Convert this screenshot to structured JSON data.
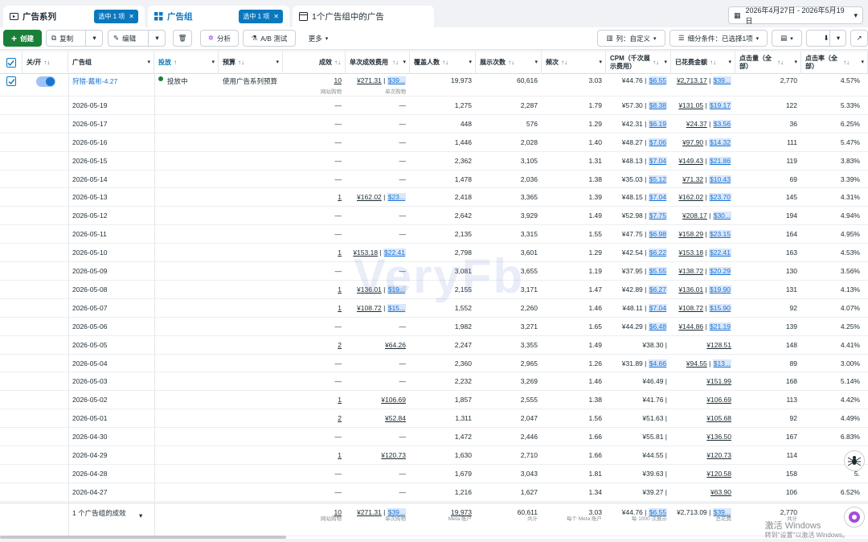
{
  "tabs": {
    "campaigns": {
      "label": "广告系列"
    },
    "adsets": {
      "label": "广告组",
      "badge": "选中 1 项"
    },
    "ads": {
      "label": "1个广告组中的广告"
    },
    "campaigns_badge": "选中 1 项"
  },
  "date_range": "2026年4月27日 - 2026年5月19日",
  "toolbar": {
    "create": "创建",
    "copy": "复制",
    "edit": "编辑",
    "analyze": "分析",
    "abtest": "A/B 测试",
    "more": "更多",
    "columns": "列：自定义",
    "breakdown": "细分条件：已选择1项"
  },
  "headers": {
    "toggle": "关/开",
    "adset": "广告组",
    "delivery": "投放",
    "budget": "预算",
    "results": "成效",
    "cost_per_result": "单次成效费用",
    "reach": "覆盖人数",
    "impressions": "展示次数",
    "frequency": "频次",
    "cpm": "CPM（千次展示费用）",
    "spend": "已花费金额",
    "clicks": "点击量（全部）",
    "ctr": "点击率（全部）"
  },
  "main_row": {
    "name": "狩猎-戴彬-4.27",
    "delivery": "投放中",
    "budget": "使用广告系列预算",
    "results": "10",
    "results_sub": "网站购物",
    "cost": "¥271.31",
    "cost_usd": "$39...",
    "cost_sub": "单次购物",
    "reach": "19,973",
    "impressions": "60,616",
    "frequency": "3.03",
    "cpm": "¥44.76",
    "cpm_usd": "$6.55",
    "spend": "¥2,713.17",
    "spend_usd": "$39...",
    "clicks": "2,770",
    "ctr": "4.57%"
  },
  "rows": [
    {
      "date": "2026-05-19",
      "results": "—",
      "cost": "—",
      "cost_usd": "",
      "reach": "1,275",
      "impressions": "2,287",
      "frequency": "1.79",
      "cpm": "¥57.30",
      "cpm_usd": "$8.38",
      "spend": "¥131.05",
      "spend_usd": "$19.17",
      "clicks": "122",
      "ctr": "5.33%"
    },
    {
      "date": "2026-05-17",
      "results": "—",
      "cost": "—",
      "cost_usd": "",
      "reach": "448",
      "impressions": "576",
      "frequency": "1.29",
      "cpm": "¥42.31",
      "cpm_usd": "$6.19",
      "spend": "¥24.37",
      "spend_usd": "$3.56",
      "clicks": "36",
      "ctr": "6.25%"
    },
    {
      "date": "2026-05-16",
      "results": "—",
      "cost": "—",
      "cost_usd": "",
      "reach": "1,446",
      "impressions": "2,028",
      "frequency": "1.40",
      "cpm": "¥48.27",
      "cpm_usd": "$7.06",
      "spend": "¥97.90",
      "spend_usd": "$14.32",
      "clicks": "111",
      "ctr": "5.47%"
    },
    {
      "date": "2026-05-15",
      "results": "—",
      "cost": "—",
      "cost_usd": "",
      "reach": "2,362",
      "impressions": "3,105",
      "frequency": "1.31",
      "cpm": "¥48.13",
      "cpm_usd": "$7.04",
      "spend": "¥149.43",
      "spend_usd": "$21.86",
      "clicks": "119",
      "ctr": "3.83%"
    },
    {
      "date": "2026-05-14",
      "results": "—",
      "cost": "—",
      "cost_usd": "",
      "reach": "1,478",
      "impressions": "2,036",
      "frequency": "1.38",
      "cpm": "¥35.03",
      "cpm_usd": "$5.12",
      "spend": "¥71.32",
      "spend_usd": "$10.43",
      "clicks": "69",
      "ctr": "3.39%"
    },
    {
      "date": "2026-05-13",
      "results": "1",
      "cost": "¥162.02",
      "cost_usd": "$23...",
      "reach": "2,418",
      "impressions": "3,365",
      "frequency": "1.39",
      "cpm": "¥48.15",
      "cpm_usd": "$7.04",
      "spend": "¥162.02",
      "spend_usd": "$23.70",
      "clicks": "145",
      "ctr": "4.31%"
    },
    {
      "date": "2026-05-12",
      "results": "—",
      "cost": "—",
      "cost_usd": "",
      "reach": "2,642",
      "impressions": "3,929",
      "frequency": "1.49",
      "cpm": "¥52.98",
      "cpm_usd": "$7.75",
      "spend": "¥208.17",
      "spend_usd": "$30...",
      "clicks": "194",
      "ctr": "4.94%"
    },
    {
      "date": "2026-05-11",
      "results": "—",
      "cost": "—",
      "cost_usd": "",
      "reach": "2,135",
      "impressions": "3,315",
      "frequency": "1.55",
      "cpm": "¥47.75",
      "cpm_usd": "$6.98",
      "spend": "¥158.29",
      "spend_usd": "$23.15",
      "clicks": "164",
      "ctr": "4.95%"
    },
    {
      "date": "2026-05-10",
      "results": "1",
      "cost": "¥153.18",
      "cost_usd": "$22.41",
      "reach": "2,798",
      "impressions": "3,601",
      "frequency": "1.29",
      "cpm": "¥42.54",
      "cpm_usd": "$6.22",
      "spend": "¥153.18",
      "spend_usd": "$22.41",
      "clicks": "163",
      "ctr": "4.53%"
    },
    {
      "date": "2026-05-09",
      "results": "—",
      "cost": "—",
      "cost_usd": "",
      "reach": "3,081",
      "impressions": "3,655",
      "frequency": "1.19",
      "cpm": "¥37.95",
      "cpm_usd": "$5.55",
      "spend": "¥138.72",
      "spend_usd": "$20.29",
      "clicks": "130",
      "ctr": "3.56%"
    },
    {
      "date": "2026-05-08",
      "results": "1",
      "cost": "¥136.01",
      "cost_usd": "$19...",
      "reach": "2,155",
      "impressions": "3,171",
      "frequency": "1.47",
      "cpm": "¥42.89",
      "cpm_usd": "$6.27",
      "spend": "¥136.01",
      "spend_usd": "$19.90",
      "clicks": "131",
      "ctr": "4.13%"
    },
    {
      "date": "2026-05-07",
      "results": "1",
      "cost": "¥108.72",
      "cost_usd": "$15...",
      "reach": "1,552",
      "impressions": "2,260",
      "frequency": "1.46",
      "cpm": "¥48.11",
      "cpm_usd": "$7.04",
      "spend": "¥108.72",
      "spend_usd": "$15.90",
      "clicks": "92",
      "ctr": "4.07%"
    },
    {
      "date": "2026-05-06",
      "results": "—",
      "cost": "—",
      "cost_usd": "",
      "reach": "1,982",
      "impressions": "3,271",
      "frequency": "1.65",
      "cpm": "¥44.29",
      "cpm_usd": "$6.48",
      "spend": "¥144.86",
      "spend_usd": "$21.19",
      "clicks": "139",
      "ctr": "4.25%"
    },
    {
      "date": "2026-05-05",
      "results": "2",
      "cost": "¥64.26",
      "cost_usd": "",
      "reach": "2,247",
      "impressions": "3,355",
      "frequency": "1.49",
      "cpm": "¥38.30",
      "cpm_usd": "",
      "spend": "¥128.51",
      "spend_usd": "",
      "clicks": "148",
      "ctr": "4.41%"
    },
    {
      "date": "2026-05-04",
      "results": "—",
      "cost": "—",
      "cost_usd": "",
      "reach": "2,360",
      "impressions": "2,965",
      "frequency": "1.26",
      "cpm": "¥31.89",
      "cpm_usd": "$4.66",
      "spend": "¥94.55",
      "spend_usd": "$13...",
      "clicks": "89",
      "ctr": "3.00%"
    },
    {
      "date": "2026-05-03",
      "results": "—",
      "cost": "—",
      "cost_usd": "",
      "reach": "2,232",
      "impressions": "3,269",
      "frequency": "1.46",
      "cpm": "¥46.49",
      "cpm_usd": "",
      "spend": "¥151.99",
      "spend_usd": "",
      "clicks": "168",
      "ctr": "5.14%"
    },
    {
      "date": "2026-05-02",
      "results": "1",
      "cost": "¥106.69",
      "cost_usd": "",
      "reach": "1,857",
      "impressions": "2,555",
      "frequency": "1.38",
      "cpm": "¥41.76",
      "cpm_usd": "",
      "spend": "¥106.69",
      "spend_usd": "",
      "clicks": "113",
      "ctr": "4.42%"
    },
    {
      "date": "2026-05-01",
      "results": "2",
      "cost": "¥52.84",
      "cost_usd": "",
      "reach": "1,311",
      "impressions": "2,047",
      "frequency": "1.56",
      "cpm": "¥51.63",
      "cpm_usd": "",
      "spend": "¥105.68",
      "spend_usd": "",
      "clicks": "92",
      "ctr": "4.49%"
    },
    {
      "date": "2026-04-30",
      "results": "—",
      "cost": "—",
      "cost_usd": "",
      "reach": "1,472",
      "impressions": "2,446",
      "frequency": "1.66",
      "cpm": "¥55.81",
      "cpm_usd": "",
      "spend": "¥136.50",
      "spend_usd": "",
      "clicks": "167",
      "ctr": "6.83%"
    },
    {
      "date": "2026-04-29",
      "results": "1",
      "cost": "¥120.73",
      "cost_usd": "",
      "reach": "1,630",
      "impressions": "2,710",
      "frequency": "1.66",
      "cpm": "¥44.55",
      "cpm_usd": "",
      "spend": "¥120.73",
      "spend_usd": "",
      "clicks": "114",
      "ctr": "4."
    },
    {
      "date": "2026-04-28",
      "results": "—",
      "cost": "—",
      "cost_usd": "",
      "reach": "1,679",
      "impressions": "3,043",
      "frequency": "1.81",
      "cpm": "¥39.63",
      "cpm_usd": "",
      "spend": "¥120.58",
      "spend_usd": "",
      "clicks": "158",
      "ctr": "5."
    },
    {
      "date": "2026-04-27",
      "results": "—",
      "cost": "—",
      "cost_usd": "",
      "reach": "1,216",
      "impressions": "1,627",
      "frequency": "1.34",
      "cpm": "¥39.27",
      "cpm_usd": "",
      "spend": "¥63.90",
      "spend_usd": "",
      "clicks": "106",
      "ctr": "6.52%"
    }
  ],
  "total": {
    "label": "1 个广告组的成效",
    "results": "10",
    "results_sub": "网站购物",
    "cost": "¥271.31",
    "cost_usd": "$39...",
    "cost_sub": "单次购物",
    "reach": "19,973",
    "reach_sub": "Meta 账户",
    "impressions": "60,611",
    "impressions_sub": "共计",
    "frequency": "3.03",
    "frequency_sub": "每个 Meta 账户",
    "cpm": "¥44.76",
    "cpm_usd": "$6.55",
    "cpm_sub": "每 1000 次展示",
    "spend": "¥2,713.09",
    "spend_usd": "$39...",
    "spend_sub": "总花费",
    "clicks": "2,770",
    "clicks_sub": "共计"
  },
  "watermark": "VeryFb",
  "windows_watermark": {
    "line1": "激活 Windows",
    "line2": "转到\"设置\"以激活 Windows。"
  }
}
